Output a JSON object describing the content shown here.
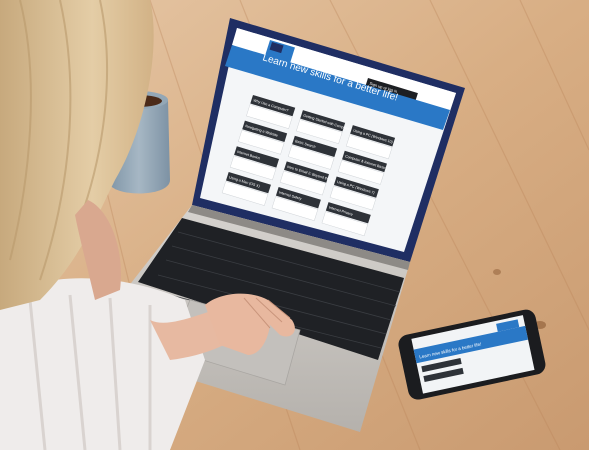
{
  "laptop_screen": {
    "header_cta": "Sign up or log in",
    "banner_headline": "Learn new skills for a better life!",
    "course_cards": [
      "Why Use a Computer?",
      "Getting Started with Computers",
      "Using a PC (Windows 10)",
      "Navigating a Website",
      "Basic Search",
      "Computer & Internet Basics",
      "Internet Basics",
      "Intro to Email 2: Beyond the Basics",
      "Using a PC (Windows 7)",
      "Using a Mac (OS X)",
      "Internet Safety",
      "Internet Privacy"
    ]
  },
  "phone_screen": {
    "banner": "Learn new skills for a better life!"
  },
  "colors": {
    "wood_light": "#d9b28c",
    "wood_dark": "#b98558",
    "laptop_silver": "#c9c6c2",
    "keyboard": "#1f2125",
    "screen_blue": "#2a78c6",
    "bezel_navy": "#1f2e63",
    "card_dark": "#2e3238",
    "shirt_white": "#efeceb",
    "hair_blonde": "#d9bf97",
    "skin": "#e7b9a1",
    "mug": "#8fa4b4"
  }
}
